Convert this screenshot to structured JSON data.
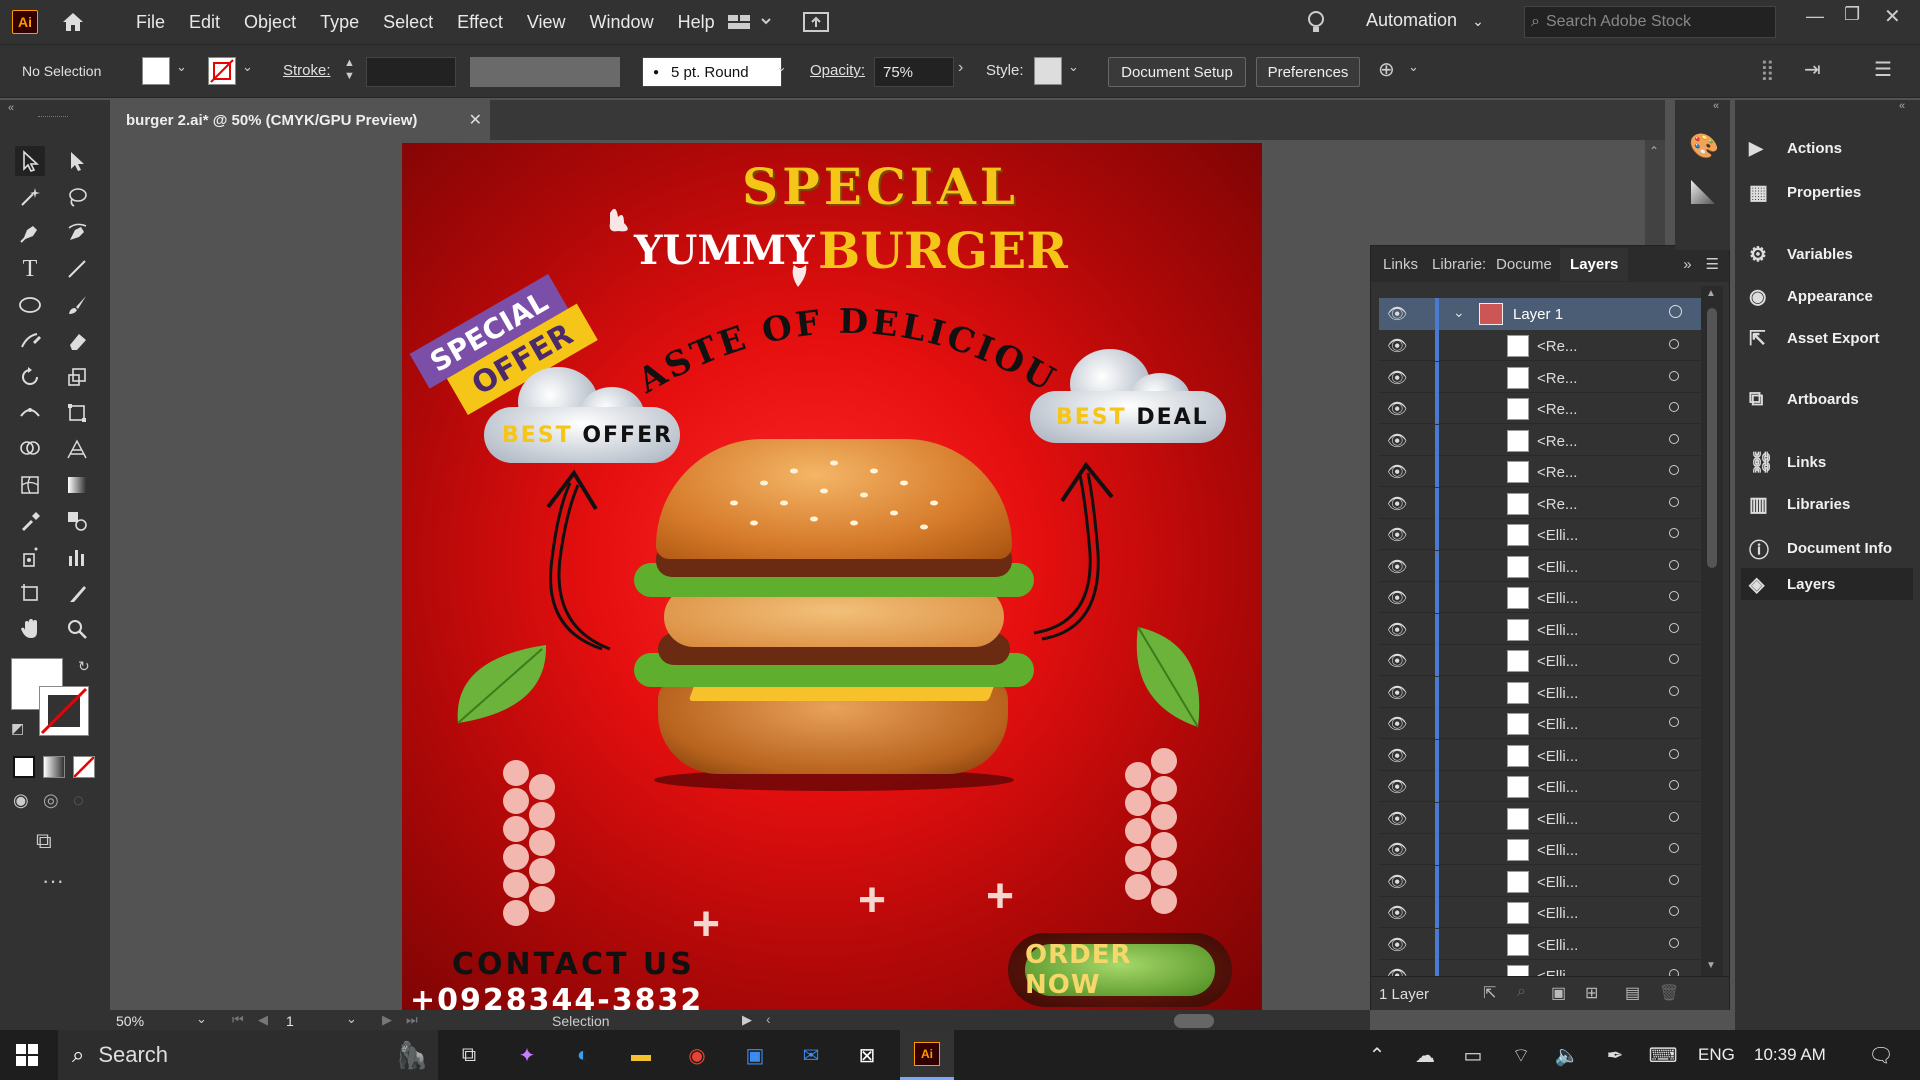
{
  "app": {
    "logo": "Ai",
    "name": "Adobe Illustrator"
  },
  "menu": [
    "File",
    "Edit",
    "Object",
    "Type",
    "Select",
    "Effect",
    "View",
    "Window",
    "Help"
  ],
  "workspace": "Automation",
  "search_stock": {
    "placeholder": "Search Adobe Stock"
  },
  "control": {
    "selection": "No Selection",
    "stroke_label": "Stroke:",
    "brush": "5 pt. Round",
    "opacity_label": "Opacity:",
    "opacity_value": "75%",
    "style_label": "Style:",
    "document_setup": "Document Setup",
    "preferences": "Preferences"
  },
  "document": {
    "tab_title": "burger 2.ai* @ 50% (CMYK/GPU Preview)"
  },
  "artwork": {
    "headline_special": "SPECIAL",
    "headline_yummy": "YUMMY",
    "headline_burger": "BURGER",
    "tagline": "TASTE OF DELICIOUS",
    "badge_line1": "SPECIAL",
    "badge_line2": "OFFER",
    "cloud_left_word1": "BEST",
    "cloud_left_word2": "OFFER",
    "cloud_right_word1": "BEST",
    "cloud_right_word2": "DEAL",
    "contact": "CONTACT US",
    "phone": "+0928344-3832",
    "cta": "ORDER NOW"
  },
  "status": {
    "zoom": "50%",
    "artboard": "1",
    "tool": "Selection"
  },
  "layers_panel": {
    "tabs": [
      "Links",
      "Librarie:",
      "Docume",
      "Layers"
    ],
    "layer_name": "Layer 1",
    "items": [
      "<Re...",
      "<Re...",
      "<Re...",
      "<Re...",
      "<Re...",
      "<Re...",
      "<Elli...",
      "<Elli...",
      "<Elli...",
      "<Elli...",
      "<Elli...",
      "<Elli...",
      "<Elli...",
      "<Elli...",
      "<Elli...",
      "<Elli...",
      "<Elli...",
      "<Elli...",
      "<Elli...",
      "<Elli...",
      "<Elli..."
    ],
    "footer": "1 Layer"
  },
  "right_panel": [
    "Actions",
    "Properties",
    "Variables",
    "Appearance",
    "Asset Export",
    "Artboards",
    "Links",
    "Libraries",
    "Document Info",
    "Layers"
  ],
  "taskbar": {
    "search": "Search",
    "language": "ENG",
    "time": "10:39 AM"
  },
  "colors": {
    "accent_yellow": "#f5c518",
    "layer_blue": "#4a7bd1",
    "artboard_red": "#e50f0f"
  }
}
